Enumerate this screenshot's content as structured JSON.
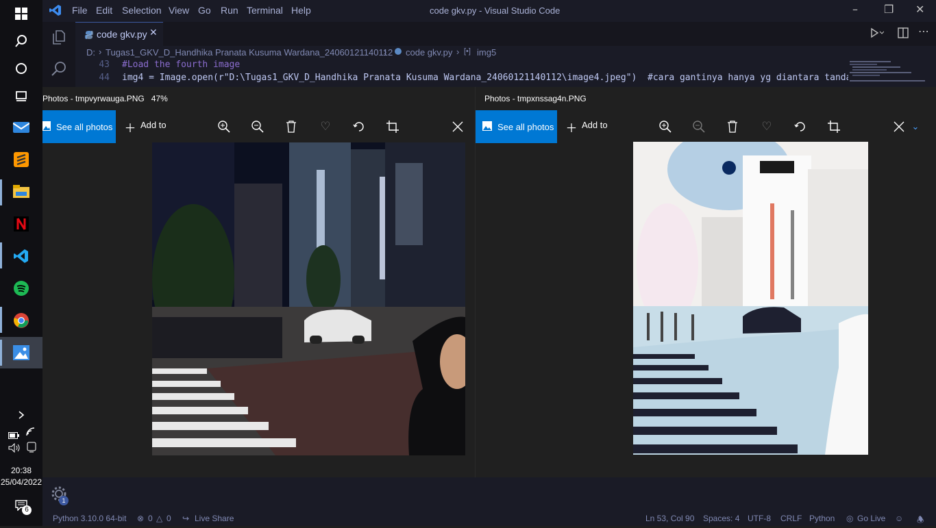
{
  "taskbar": {
    "clock_time": "20:38",
    "clock_date": "25/04/2022",
    "notification_count": "6"
  },
  "vscode": {
    "window_title": "code gkv.py - Visual Studio Code",
    "menu": [
      "File",
      "Edit",
      "Selection",
      "View",
      "Go",
      "Run",
      "Terminal",
      "Help"
    ],
    "tab_label": "code gkv.py",
    "breadcrumb": {
      "drive": "D:",
      "folder": "Tugas1_GKV_D_Handhika Pranata Kusuma Wardana_24060121140112",
      "file": "code gkv.py",
      "symbol": "img5"
    },
    "code_lines": [
      {
        "num": "43",
        "text": "#Load the fourth image"
      },
      {
        "num": "44",
        "text": "img4 = Image.open(r\"D:\\Tugas1_GKV_D_Handhika Pranata Kusuma Wardana_24060121140112\\image4.jpeg\")  #cara gantinya hanya yg diantara tanda"
      }
    ],
    "accounts_badge": "1",
    "status": {
      "python": "Python 3.10.0 64-bit",
      "errors": "0",
      "warnings": "0",
      "live_share": "Live Share",
      "cursor": "Ln 53, Col 90",
      "spaces": "Spaces: 4",
      "encoding": "UTF-8",
      "eol": "CRLF",
      "language": "Python",
      "go_live": "Go Live"
    }
  },
  "photos_left": {
    "title": "Photos - tmpvyrwauga.PNG",
    "zoom": "47%",
    "see_all": "See all photos",
    "add_to": "Add to"
  },
  "photos_right": {
    "title": "Photos - tmpxnssag4n.PNG",
    "see_all": "See all photos",
    "add_to": "Add to"
  },
  "colors": {
    "accent": "#0078d4",
    "editor_bg": "#1a1b26",
    "photos_bg": "#202020"
  }
}
